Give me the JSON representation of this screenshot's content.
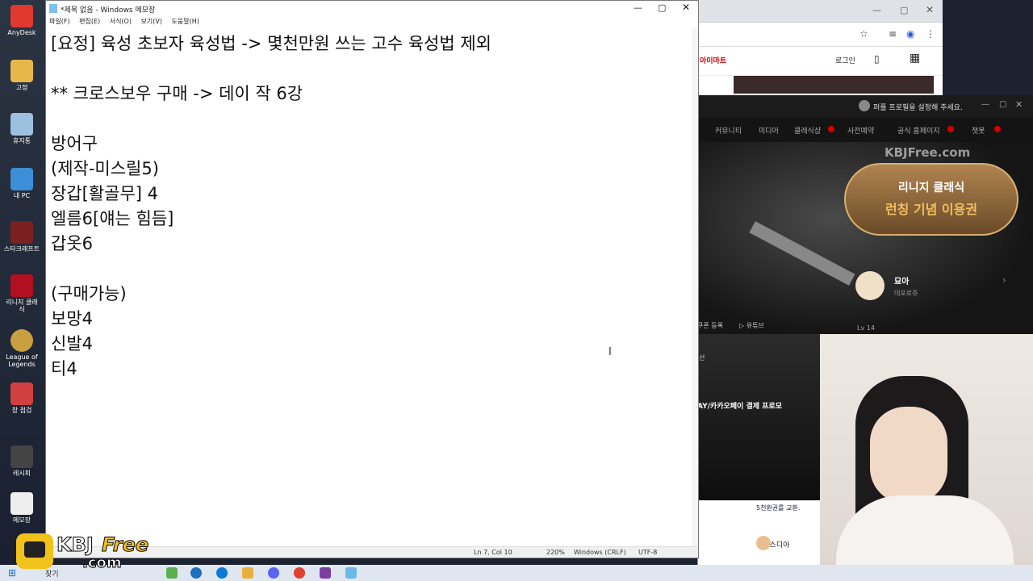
{
  "desktop": {
    "icons": [
      "AnyDesk",
      "고정",
      "휴지통",
      "내 PC",
      "스타크래프트",
      "리니지 클래식",
      "League of Legends",
      "창 점검",
      "레시피",
      "메모장"
    ]
  },
  "notepad": {
    "title": "*제목 없음 - Windows 메모장",
    "menu": [
      "파일(F)",
      "편집(E)",
      "서식(O)",
      "보기(V)",
      "도움말(H)"
    ],
    "lines": [
      "[요정] 육성 초보자 육성법 -> 몇천만원 쓰는 고수 육성법 제외",
      "",
      "** 크로스보우 구매 -> 데이 작 6강",
      "",
      "방어구",
      "(제작-미스릴5)",
      "장갑[활골무] 4",
      "엘름6[얘는 힘듬]",
      "갑옷6",
      "",
      "(구매가능)",
      "보망4",
      "신발4",
      "티4"
    ],
    "status": {
      "position": "Ln 7, Col 10",
      "zoom": "220%",
      "line_ending": "Windows (CRLF)",
      "encoding": "UTF-8"
    }
  },
  "browser": {
    "site_link": "아이마트",
    "login": "로그인"
  },
  "launcher": {
    "profile_prompt": "퍼플 프로필을 설정해 주세요.",
    "nav": [
      "커뮤니티",
      "미디어",
      "클래식샵",
      "사전예약",
      "공식 홈페이지",
      "챗봇"
    ],
    "watermark": "KBJFree.com",
    "banner_top": "리니지 클래식",
    "banner_main": "런칭 기념 이용권",
    "char_name": "묘아",
    "char_server": "데포로쥬",
    "level": "Lv  14",
    "youtube": "유튜브",
    "register": "쿠폰 등록",
    "promo": "AY/카카오페이 결제 프로모",
    "side_label": "선"
  },
  "bg_page": {
    "snippet1": "5천환권를 교환.",
    "snippet2": "어비스디아"
  },
  "taskbar": {
    "search": "찾기"
  },
  "watermark_logo": {
    "line1": "KBJ",
    "line2": "Free",
    "line3": "com"
  },
  "colors": {
    "accent": "#d00000",
    "launcher_bg": "#121212",
    "banner_gold": "#f0c060"
  }
}
